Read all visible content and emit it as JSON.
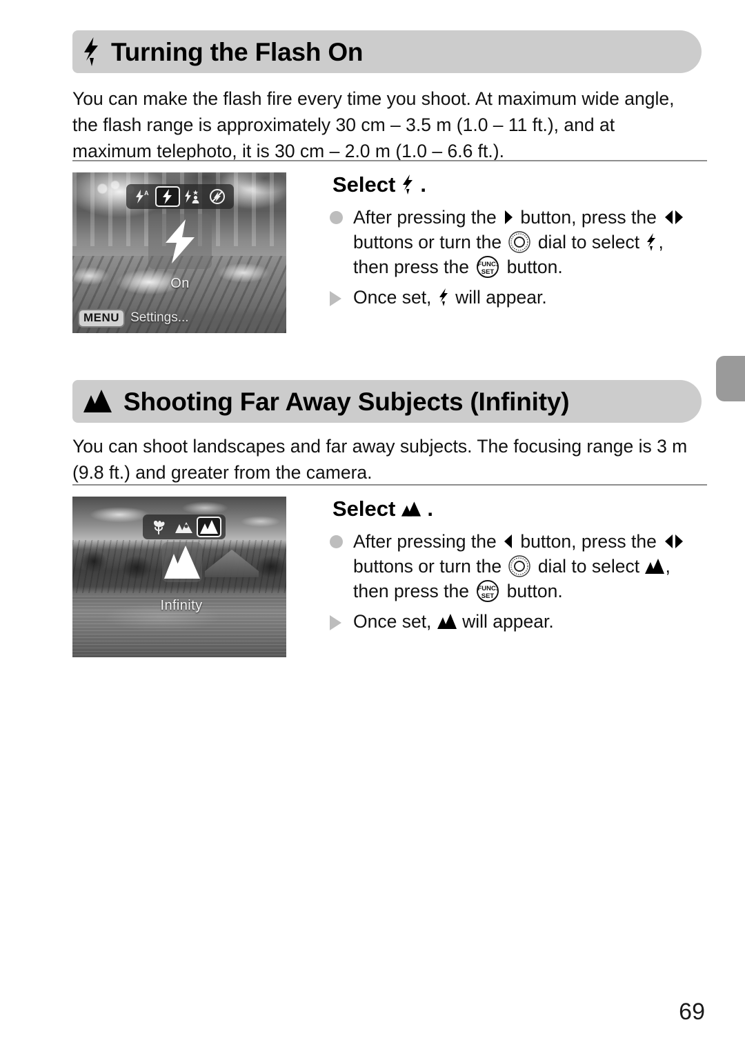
{
  "page": {
    "number": "69",
    "edge_tab_color": "#9a9a9a",
    "banner_color": "#cccccc"
  },
  "sections": [
    {
      "id": "flash-on",
      "icon": "flash-bolt-icon",
      "title": "Turning the Flash On",
      "intro_lines": [
        "You can make the flash fire every time you shoot. At maximum wide angle,",
        "the flash range is approximately 30 cm – 3.5 m (1.0 – 11 ft.), and at",
        "maximum telephoto, it is 30 cm – 2.0 m (1.0 – 6.6 ft.)."
      ],
      "screen": {
        "scene": "restaurant-interior",
        "mode_icons": [
          {
            "name": "flash-auto-icon",
            "selected": false
          },
          {
            "name": "flash-on-icon",
            "selected": true
          },
          {
            "name": "flash-slow-sync-icon",
            "selected": false
          },
          {
            "name": "flash-off-icon",
            "selected": false
          }
        ],
        "big_icon": "flash-bolt-icon",
        "status_label": "On",
        "menu_badge": "MENU",
        "menu_text": "Settings..."
      },
      "steps": {
        "title_prefix": "Select",
        "title_icon": "flash-bolt-icon",
        "title_suffix": ".",
        "bullet_dot": {
          "lines": [
            [
              {
                "type": "text",
                "value": "After pressing the "
              },
              {
                "type": "icon",
                "value": "arrow-right-button-icon"
              },
              {
                "type": "text",
                "value": " button, press the "
              },
              {
                "type": "icon",
                "value": "arrow-left-right-buttons-icon"
              }
            ],
            [
              {
                "type": "text",
                "value": "buttons or turn the "
              },
              {
                "type": "icon",
                "value": "control-dial-icon"
              },
              {
                "type": "text",
                "value": " dial to select "
              },
              {
                "type": "icon",
                "value": "flash-bolt-icon"
              },
              {
                "type": "text",
                "value": ","
              }
            ],
            [
              {
                "type": "text",
                "value": "then press the "
              },
              {
                "type": "icon",
                "value": "func-set-button-icon"
              },
              {
                "type": "text",
                "value": " button."
              }
            ]
          ]
        },
        "bullet_triangle": {
          "lines": [
            [
              {
                "type": "text",
                "value": "Once set, "
              },
              {
                "type": "icon",
                "value": "flash-bolt-icon"
              },
              {
                "type": "text",
                "value": " will appear."
              }
            ]
          ]
        }
      }
    },
    {
      "id": "infinity",
      "icon": "mountains-icon",
      "title": "Shooting Far Away Subjects (Infinity)",
      "intro_lines": [
        "You can shoot landscapes and far away subjects. The focusing range is 3 m",
        "(9.8 ft.) and greater from the camera."
      ],
      "screen": {
        "scene": "tropical-landscape",
        "mode_icons": [
          {
            "name": "macro-tulip-icon",
            "selected": false
          },
          {
            "name": "normal-focus-icon",
            "selected": false
          },
          {
            "name": "infinity-mountains-icon",
            "selected": true
          }
        ],
        "big_icon": "mountains-icon",
        "status_label": "Infinity"
      },
      "steps": {
        "title_prefix": "Select",
        "title_icon": "mountains-icon",
        "title_suffix": ".",
        "bullet_dot": {
          "lines": [
            [
              {
                "type": "text",
                "value": "After pressing the "
              },
              {
                "type": "icon",
                "value": "arrow-left-button-icon"
              },
              {
                "type": "text",
                "value": " button, press the "
              },
              {
                "type": "icon",
                "value": "arrow-left-right-buttons-icon"
              }
            ],
            [
              {
                "type": "text",
                "value": "buttons or turn the "
              },
              {
                "type": "icon",
                "value": "control-dial-icon"
              },
              {
                "type": "text",
                "value": " dial to select "
              },
              {
                "type": "icon",
                "value": "mountains-icon"
              },
              {
                "type": "text",
                "value": ","
              }
            ],
            [
              {
                "type": "text",
                "value": "then press the "
              },
              {
                "type": "icon",
                "value": "func-set-button-icon"
              },
              {
                "type": "text",
                "value": " button."
              }
            ]
          ]
        },
        "bullet_triangle": {
          "lines": [
            [
              {
                "type": "text",
                "value": "Once set, "
              },
              {
                "type": "icon",
                "value": "mountains-icon"
              },
              {
                "type": "text",
                "value": " will appear."
              }
            ]
          ]
        }
      }
    }
  ]
}
